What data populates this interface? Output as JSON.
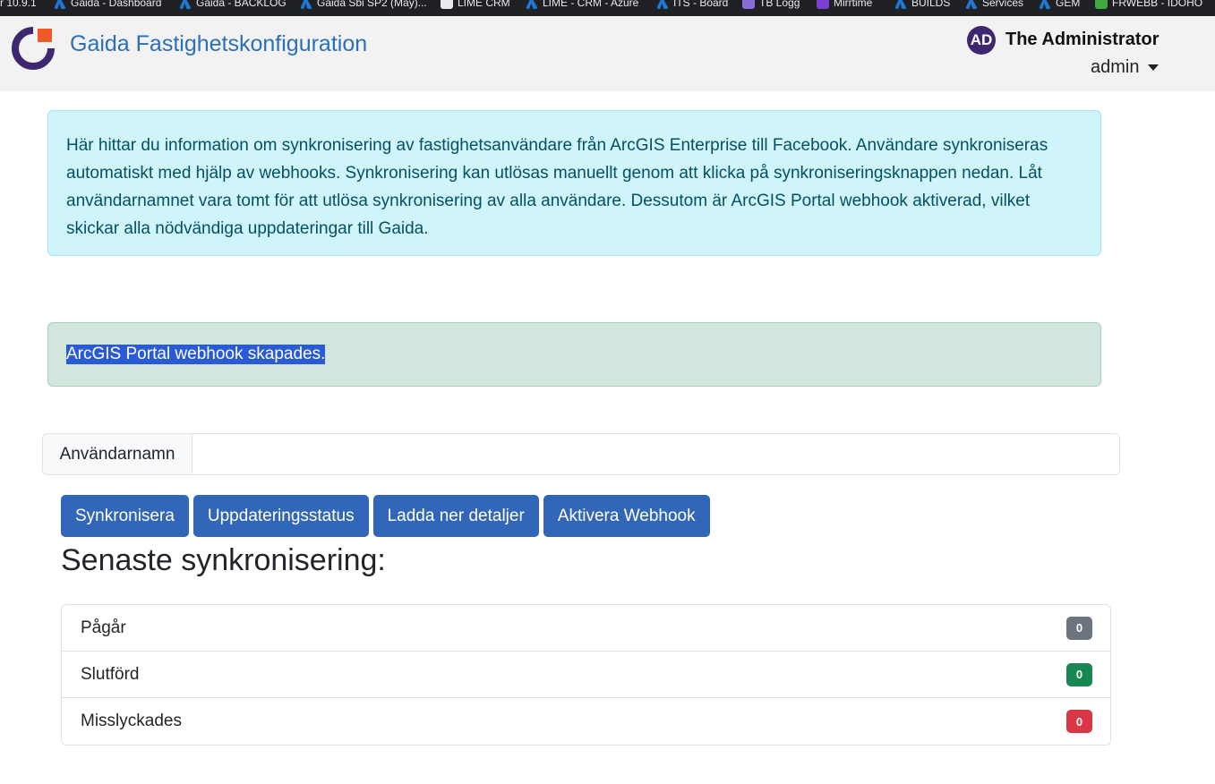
{
  "bookmarks": [
    {
      "label": "r 10.9.1",
      "icon": "",
      "icon_class": ""
    },
    {
      "label": "Gaida - Dashboard",
      "icon": "azure-devops-icon",
      "icon_class": "ic-az"
    },
    {
      "label": "Gaida - BACKLOG",
      "icon": "azure-devops-icon",
      "icon_class": "ic-az"
    },
    {
      "label": "Gaida Sbi SP2 (May)...",
      "icon": "azure-devops-icon",
      "icon_class": "ic-az"
    },
    {
      "label": "LIME CRM",
      "icon": "chat-icon",
      "icon_class": "ic-chat"
    },
    {
      "label": "LIME - CRM - Azure",
      "icon": "azure-devops-icon",
      "icon_class": "ic-az"
    },
    {
      "label": "ITS - Board",
      "icon": "azure-devops-icon",
      "icon_class": "ic-az"
    },
    {
      "label": "TB Logg",
      "icon": "timelog-icon",
      "icon_class": "ic-tp"
    },
    {
      "label": "Mirrtime",
      "icon": "mirrtime-icon",
      "icon_class": "ic-m"
    },
    {
      "label": "BUILDS",
      "icon": "azure-devops-icon",
      "icon_class": "ic-az"
    },
    {
      "label": "Services",
      "icon": "azure-devops-icon",
      "icon_class": "ic-az"
    },
    {
      "label": "GEM",
      "icon": "azure-devops-icon",
      "icon_class": "ic-az"
    },
    {
      "label": "FRWEBB - IDOHO",
      "icon": "nvidia-icon",
      "icon_class": "ic-nv"
    }
  ],
  "header": {
    "brand": "Gaida Fastighetskonfiguration",
    "avatar_initials": "AD",
    "user_name": "The Administrator",
    "user_menu": "admin"
  },
  "info_alert": "Här hittar du information om synkronisering av fastighetsanvändare från ArcGIS Enterprise till Facebook. Användare synkroniseras automatiskt med hjälp av webhooks. Synkronisering kan utlösas manuellt genom att klicka på synkroniseringsknappen nedan. Låt användarnamnet vara tomt för att utlösa synkronisering av alla användare. Dessutom är ArcGIS Portal webhook aktiverad, vilket skickar alla nödvändiga uppdateringar till Gaida.",
  "success_alert": "ArcGIS Portal webhook skapades.",
  "username_input": {
    "label": "Användarnamn",
    "value": ""
  },
  "buttons": {
    "sync": "Synkronisera",
    "update_status": "Uppdateringsstatus",
    "download_details": "Ladda ner detaljer",
    "activate_webhook": "Aktivera Webhook"
  },
  "latest_sync": {
    "title": "Senaste synkronisering:",
    "items": [
      {
        "label": "Pågår",
        "count": "0",
        "color": "#6c757d"
      },
      {
        "label": "Slutförd",
        "count": "0",
        "color": "#198754"
      },
      {
        "label": "Misslyckades",
        "count": "0",
        "color": "#dc3545"
      }
    ]
  }
}
